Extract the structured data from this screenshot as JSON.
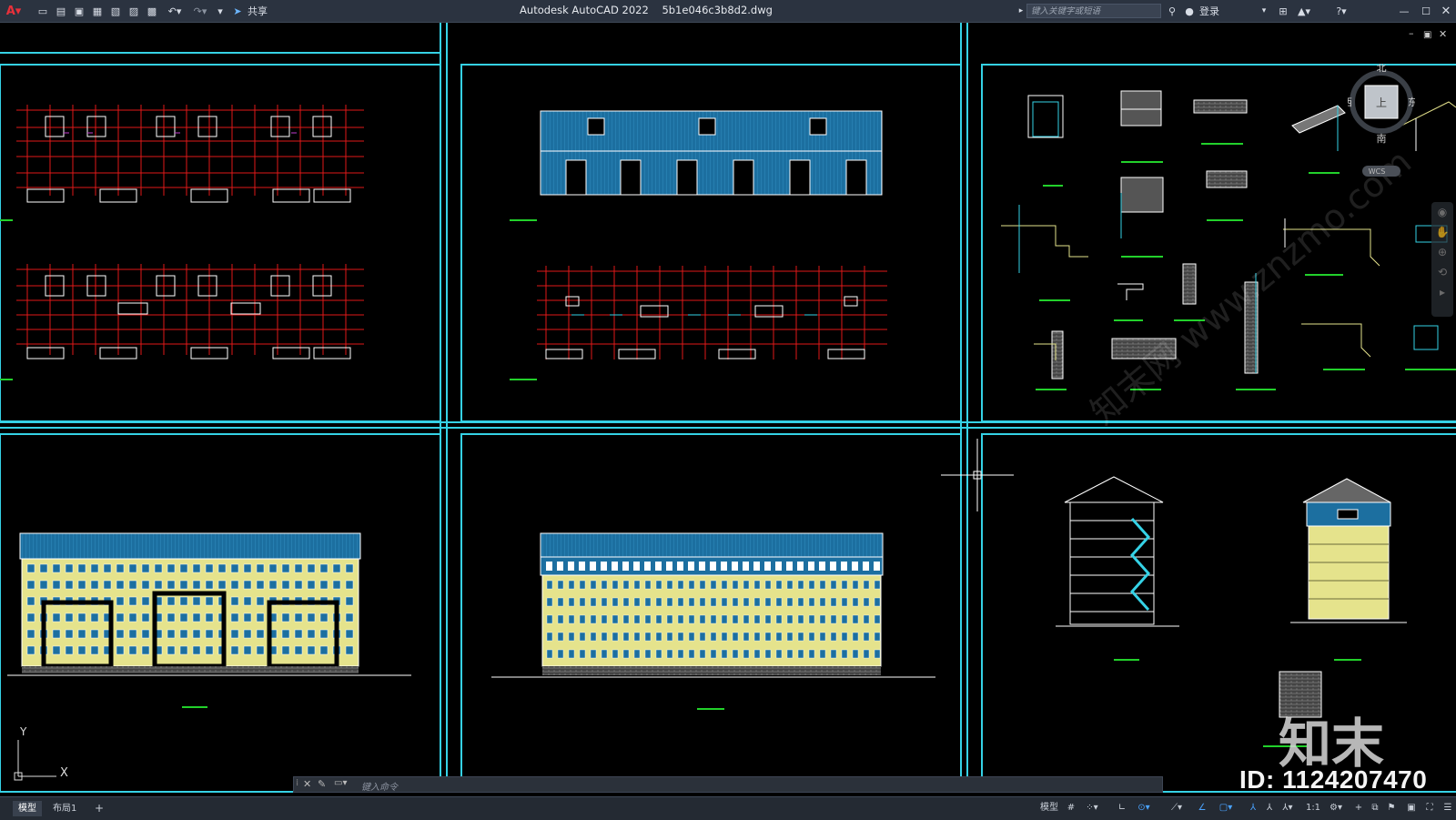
{
  "app": {
    "title": "Autodesk AutoCAD 2022",
    "filename": "5b1e046c3b8d2.dwg",
    "share_label": "共享",
    "search_placeholder": "键入关键字或短语",
    "login_label": "登录"
  },
  "viewcube": {
    "north": "北",
    "south": "南",
    "west": "西",
    "east": "东",
    "top_face": "上",
    "wcs_label": "WCS"
  },
  "ucs": {
    "y": "Y",
    "x": "X"
  },
  "command": {
    "placeholder": "键入命令"
  },
  "layout_tabs": [
    {
      "label": "模型",
      "active": true
    },
    {
      "label": "布局1",
      "active": false
    }
  ],
  "add_tab_label": "+",
  "statusbar": {
    "model_label": "模型",
    "scale_label": "1:1"
  },
  "watermark": {
    "brand": "知末",
    "id_text": "ID: 1124207470",
    "site": "www.znzmo.com",
    "site_cn": "知末网"
  },
  "colors": {
    "frame": "#35d2e6",
    "plan_red": "#e01919",
    "roof_blue": "#1c6fa0",
    "facade_yellow": "#e5e38c",
    "dim_green": "#22d12b",
    "titlebar": "#2b3340"
  }
}
